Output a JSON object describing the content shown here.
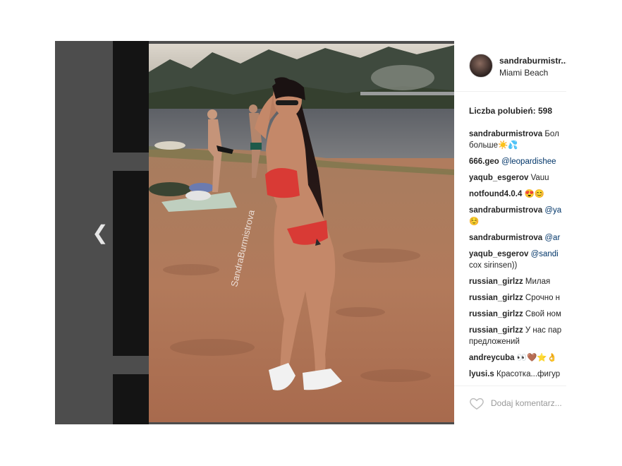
{
  "post": {
    "username": "sandraburmistr...",
    "location": "Miami Beach",
    "likes_text": "Liczba polubień: 598",
    "watermark": "SandraBurmistrova"
  },
  "comments": [
    {
      "user": "sandraburmistrova",
      "text": " Бол",
      "text2": "больше☀️💦"
    },
    {
      "user": "666.geo",
      "mention": " @leopardishee"
    },
    {
      "user": "yaqub_esgerov",
      "text": " Vauu"
    },
    {
      "user": "notfound4.0.4",
      "text": " 😍😊"
    },
    {
      "user": "sandraburmistrova",
      "mention": " @ya",
      "text2": "☺️"
    },
    {
      "user": "sandraburmistrova",
      "mention": " @ar"
    },
    {
      "user": "yaqub_esgerov",
      "mention": " @sandi",
      "text2": "cox sirinsen))"
    },
    {
      "user": "russian_girlzz",
      "text": " Милая"
    },
    {
      "user": "russian_girlzz",
      "text": " Срочно н"
    },
    {
      "user": "russian_girlzz",
      "text": " Свой ном"
    },
    {
      "user": "russian_girlzz",
      "text": " У нас пар",
      "text2": "предложений"
    },
    {
      "user": "andreycuba",
      "text": " 👀🤎⭐👌"
    },
    {
      "user": "lyusi.s",
      "text": " Красотка...фигур"
    }
  ],
  "footer": {
    "comment_placeholder": "Dodaj komentarz..."
  },
  "nav": {
    "prev_glyph": "❮"
  },
  "colors": {
    "panel_text": "#262626",
    "mention": "#003569",
    "overlay": "#4d4d4d"
  }
}
